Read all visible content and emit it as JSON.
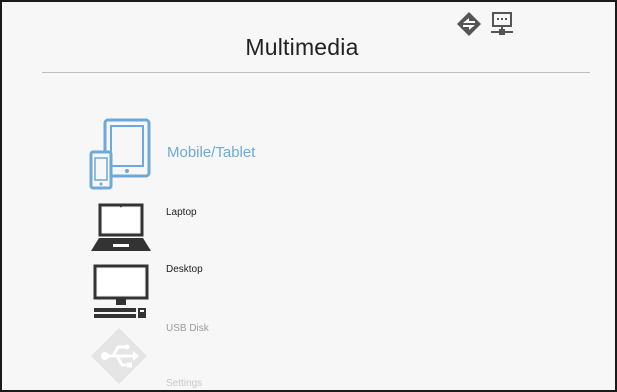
{
  "header": {
    "title": "Multimedia",
    "status_icons": [
      "wireless-projection-icon",
      "lan-network-icon"
    ]
  },
  "menu": {
    "items": [
      {
        "label": "Mobile/Tablet",
        "icon": "mobile-tablet-icon",
        "state": "selected"
      },
      {
        "label": "Laptop",
        "icon": "laptop-icon",
        "state": "normal"
      },
      {
        "label": "Desktop",
        "icon": "desktop-icon",
        "state": "normal"
      },
      {
        "label": "USB Disk",
        "icon": "usb-disk-icon",
        "state": "faded"
      },
      {
        "label": "Settings",
        "icon": "settings-icon",
        "state": "faded"
      }
    ]
  },
  "colors": {
    "accent": "#6ea9d8",
    "text": "#1d1d1d",
    "faded_text": "#9a9a9a",
    "background": "#f7f7f7",
    "divider": "#bdbdbd"
  }
}
